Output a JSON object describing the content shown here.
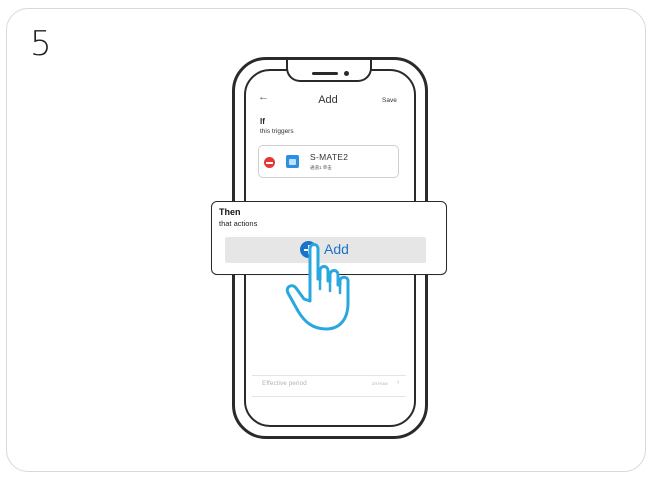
{
  "step": {
    "number": "5"
  },
  "header": {
    "back_icon": "arrow-left-icon",
    "title": "Add",
    "save_label": "Save"
  },
  "if_section": {
    "heading": "If",
    "subheading": "this triggers",
    "trigger": {
      "name": "S-MATE2",
      "detail": "通道1 单击",
      "remove_icon": "minus-circle-icon",
      "device_icon": "device-icon"
    }
  },
  "then_section": {
    "heading": "Then",
    "subheading": "that actions",
    "add_label": "Add",
    "add_icon": "plus-circle-icon"
  },
  "effective_period": {
    "label": "Effective period",
    "value": "24 Hour",
    "chevron": "›"
  },
  "colors": {
    "accent": "#1a73c8",
    "remove": "#e53935",
    "outline": "#2a2a2a",
    "hand": "#29a8e0"
  }
}
